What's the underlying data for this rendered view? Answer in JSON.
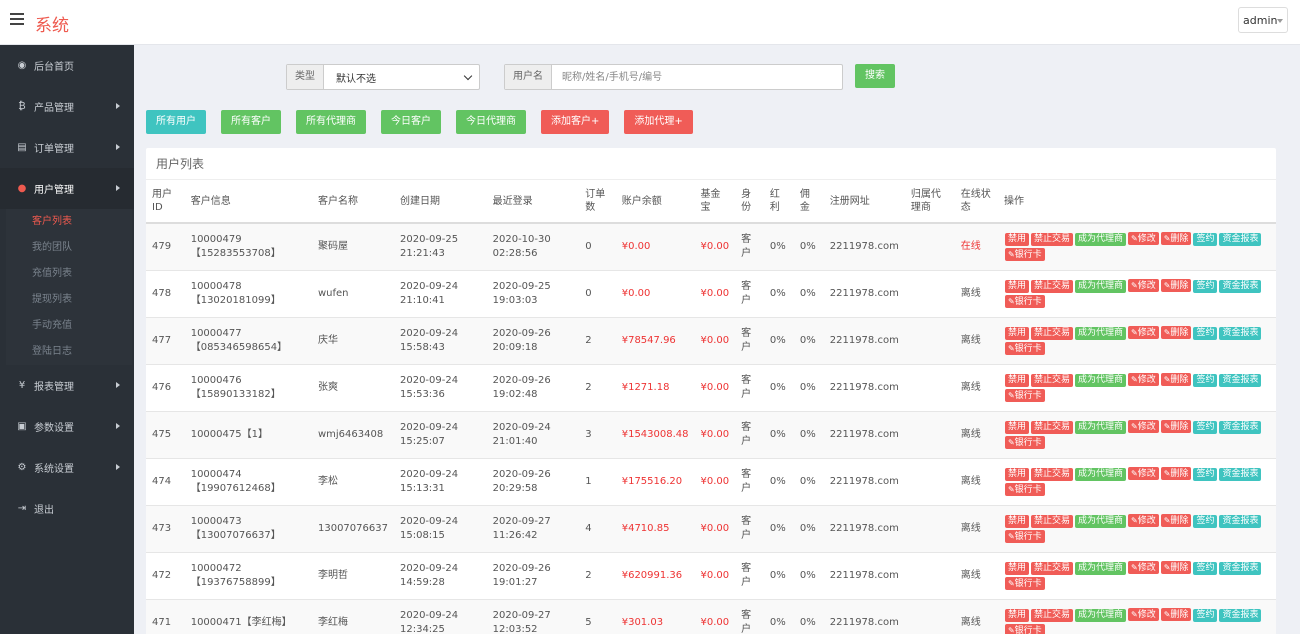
{
  "header": {
    "title": "系统",
    "user": "admin"
  },
  "sidebar": {
    "items": [
      {
        "icon": "dashboard-icon",
        "glyph": "◉",
        "label": "后台首页",
        "arrow": false
      },
      {
        "icon": "bitcoin-icon",
        "glyph": "₿",
        "label": "产品管理",
        "arrow": true
      },
      {
        "icon": "order-icon",
        "glyph": "▤",
        "label": "订单管理",
        "arrow": true
      },
      {
        "icon": "user-icon",
        "glyph": "●",
        "label": "用户管理",
        "arrow": true,
        "active": true,
        "children": [
          "客户列表",
          "我的团队",
          "充值列表",
          "提现列表",
          "手动充值",
          "登陆日志"
        ]
      },
      {
        "icon": "yen-icon",
        "glyph": "¥",
        "label": "报表管理",
        "arrow": true
      },
      {
        "icon": "params-icon",
        "glyph": "▣",
        "label": "参数设置",
        "arrow": true
      },
      {
        "icon": "gears-icon",
        "glyph": "⚙",
        "label": "系统设置",
        "arrow": true
      },
      {
        "icon": "logout-icon",
        "glyph": "⇥",
        "label": "退出",
        "arrow": false
      }
    ]
  },
  "search": {
    "type_label": "类型",
    "type_value": "默认不选",
    "username_label": "用户名",
    "username_placeholder": "昵称/姓名/手机号/编号",
    "search_button": "搜索"
  },
  "filters": [
    {
      "label": "所有用户",
      "color": "teal"
    },
    {
      "label": "所有客户",
      "color": "green"
    },
    {
      "label": "所有代理商",
      "color": "green"
    },
    {
      "label": "今日客户",
      "color": "green"
    },
    {
      "label": "今日代理商",
      "color": "green"
    },
    {
      "label": "添加客户+",
      "color": "red"
    },
    {
      "label": "添加代理+",
      "color": "red"
    }
  ],
  "panel_title": "用户列表",
  "table": {
    "headers": [
      "用户ID",
      "客户信息",
      "客户名称",
      "创建日期",
      "最近登录",
      "订单数",
      "账户余额",
      "基金宝",
      "身份",
      "红利",
      "佣金",
      "注册网址",
      "归属代理商",
      "在线状态",
      "操作"
    ],
    "rows": [
      {
        "id": "479",
        "info": "10000479【15283553708】",
        "name": "聚码屋",
        "created": "2020-09-25 21:21:43",
        "last_login": "2020-10-30 02:28:56",
        "orders": "0",
        "balance": "¥0.00",
        "fund": "¥0.00",
        "role": "客户",
        "bonus": "0%",
        "commission": "0%",
        "site": "2211978.com",
        "agent": "",
        "status": "在线",
        "online": true
      },
      {
        "id": "478",
        "info": "10000478【13020181099】",
        "name": "wufen",
        "created": "2020-09-24 21:10:41",
        "last_login": "2020-09-25 19:03:03",
        "orders": "0",
        "balance": "¥0.00",
        "fund": "¥0.00",
        "role": "客户",
        "bonus": "0%",
        "commission": "0%",
        "site": "2211978.com",
        "agent": "",
        "status": "离线",
        "online": false
      },
      {
        "id": "477",
        "info": "10000477【085346598654】",
        "name": "庆华",
        "created": "2020-09-24 15:58:43",
        "last_login": "2020-09-26 20:09:18",
        "orders": "2",
        "balance": "¥78547.96",
        "fund": "¥0.00",
        "role": "客户",
        "bonus": "0%",
        "commission": "0%",
        "site": "2211978.com",
        "agent": "",
        "status": "离线",
        "online": false
      },
      {
        "id": "476",
        "info": "10000476【15890133182】",
        "name": "张爽",
        "created": "2020-09-24 15:53:36",
        "last_login": "2020-09-26 19:02:48",
        "orders": "2",
        "balance": "¥1271.18",
        "fund": "¥0.00",
        "role": "客户",
        "bonus": "0%",
        "commission": "0%",
        "site": "2211978.com",
        "agent": "",
        "status": "离线",
        "online": false
      },
      {
        "id": "475",
        "info": "10000475【1】",
        "name": "wmj6463408",
        "created": "2020-09-24 15:25:07",
        "last_login": "2020-09-24 21:01:40",
        "orders": "3",
        "balance": "¥1543008.48",
        "fund": "¥0.00",
        "role": "客户",
        "bonus": "0%",
        "commission": "0%",
        "site": "2211978.com",
        "agent": "",
        "status": "离线",
        "online": false
      },
      {
        "id": "474",
        "info": "10000474【19907612468】",
        "name": "李松",
        "created": "2020-09-24 15:13:31",
        "last_login": "2020-09-26 20:29:58",
        "orders": "1",
        "balance": "¥175516.20",
        "fund": "¥0.00",
        "role": "客户",
        "bonus": "0%",
        "commission": "0%",
        "site": "2211978.com",
        "agent": "",
        "status": "离线",
        "online": false
      },
      {
        "id": "473",
        "info": "10000473【13007076637】",
        "name": "13007076637",
        "created": "2020-09-24 15:08:15",
        "last_login": "2020-09-27 11:26:42",
        "orders": "4",
        "balance": "¥4710.85",
        "fund": "¥0.00",
        "role": "客户",
        "bonus": "0%",
        "commission": "0%",
        "site": "2211978.com",
        "agent": "",
        "status": "离线",
        "online": false
      },
      {
        "id": "472",
        "info": "10000472【19376758899】",
        "name": "李明哲",
        "created": "2020-09-24 14:59:28",
        "last_login": "2020-09-26 19:01:27",
        "orders": "2",
        "balance": "¥620991.36",
        "fund": "¥0.00",
        "role": "客户",
        "bonus": "0%",
        "commission": "0%",
        "site": "2211978.com",
        "agent": "",
        "status": "离线",
        "online": false
      },
      {
        "id": "471",
        "info": "10000471【李红梅】",
        "name": "李红梅",
        "created": "2020-09-24 12:34:25",
        "last_login": "2020-09-27 12:03:52",
        "orders": "5",
        "balance": "¥301.03",
        "fund": "¥0.00",
        "role": "客户",
        "bonus": "0%",
        "commission": "0%",
        "site": "2211978.com",
        "agent": "",
        "status": "离线",
        "online": false
      }
    ],
    "actions": [
      {
        "label": "禁用",
        "color": "red",
        "pen": false
      },
      {
        "label": "禁止交易",
        "color": "red",
        "pen": false
      },
      {
        "label": "成为代理商",
        "color": "green",
        "pen": false
      },
      {
        "label": "修改",
        "color": "red",
        "pen": true
      },
      {
        "label": "删除",
        "color": "red",
        "pen": true
      },
      {
        "label": "签约",
        "color": "teal",
        "pen": false
      },
      {
        "label": "资金报表",
        "color": "teal",
        "pen": false
      },
      {
        "label": "银行卡",
        "color": "red",
        "pen": true
      }
    ]
  },
  "colors": {
    "accent": "#ee5a4f",
    "green": "#62c462",
    "teal": "#3fc4c0",
    "red": "#f05c57",
    "sidebar": "#2a3037"
  }
}
